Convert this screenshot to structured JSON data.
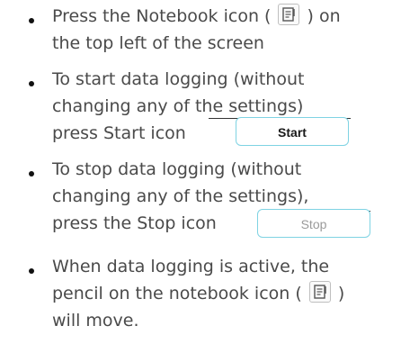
{
  "items": [
    {
      "lines": [
        {
          "before": "Press the Notebook icon (",
          "after": ") on"
        },
        {
          "text": "the top left of the screen"
        }
      ]
    },
    {
      "lines": [
        {
          "text": "To start data logging (without"
        },
        {
          "text": "changing any of the settings)"
        },
        {
          "text": "press Start icon"
        }
      ],
      "button_label": "Start"
    },
    {
      "lines": [
        {
          "text": "To stop data logging (without"
        },
        {
          "text": "changing any of the settings),"
        },
        {
          "text": "press the Stop icon"
        }
      ],
      "button_label": "Stop"
    },
    {
      "lines": [
        {
          "text": "When data logging is active, the"
        },
        {
          "before": "pencil on the notebook icon (",
          "after": ")"
        },
        {
          "text": "will move."
        }
      ]
    }
  ],
  "icons": {
    "notebook": "notebook-icon"
  },
  "colors": {
    "text": "#4a4a4a",
    "button_border": "#7fd3e3",
    "start_text": "#1a1a1a",
    "stop_text": "#9a9a9a"
  }
}
